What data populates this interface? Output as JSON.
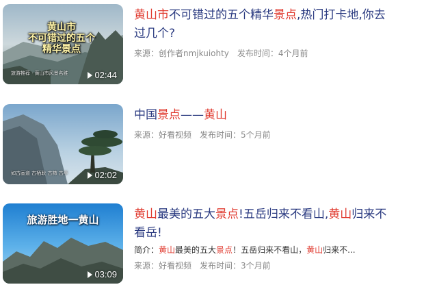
{
  "items": [
    {
      "thumb_overlay": [
        "黄山市",
        "不可错过的五个",
        "精华景点"
      ],
      "thumb_caption": "旅游推荐 · 黄山市风景名胜",
      "duration": "02:44",
      "title_parts": [
        {
          "text": "黄山市",
          "hl": true
        },
        {
          "text": "不可错过的五个精华",
          "hl": false
        },
        {
          "text": "景点",
          "hl": true
        },
        {
          "text": ",热门打卡地,你去过几个?",
          "hl": false
        }
      ],
      "source": "来源：创作者nmjkuiohty",
      "publish": "发布时间：4个月前"
    },
    {
      "thumb_overlay": [],
      "thumb_caption": "如古画道 古栖耿 古柿 古亭",
      "duration": "02:02",
      "title_parts": [
        {
          "text": "中国",
          "hl": false
        },
        {
          "text": "景点",
          "hl": true
        },
        {
          "text": "——",
          "hl": false
        },
        {
          "text": "黄山",
          "hl": true
        }
      ],
      "source": "来源：好看视频",
      "publish": "发布时间：5个月前"
    },
    {
      "thumb_overlay": [
        "旅游胜地一黄山"
      ],
      "thumb_caption": "",
      "duration": "03:09",
      "title_parts": [
        {
          "text": "黄山",
          "hl": true
        },
        {
          "text": "最美的五大",
          "hl": false
        },
        {
          "text": "景点",
          "hl": true
        },
        {
          "text": "!五岳归来不看山,",
          "hl": false
        },
        {
          "text": "黄山",
          "hl": true
        },
        {
          "text": "归来不看岳!",
          "hl": false
        }
      ],
      "desc_parts": [
        {
          "text": "简介：",
          "hl": false
        },
        {
          "text": "黄山",
          "hl": true
        },
        {
          "text": "最美的五大",
          "hl": false
        },
        {
          "text": "景点",
          "hl": true
        },
        {
          "text": "！五岳归来不看山，",
          "hl": false
        },
        {
          "text": "黄山",
          "hl": true
        },
        {
          "text": "归来不...",
          "hl": false
        }
      ],
      "source": "来源：好看视频",
      "publish": "发布时间：3个月前"
    }
  ],
  "colors": {
    "title": "#2a3a80",
    "highlight": "#e03a2f",
    "meta": "#8a8a8a"
  },
  "icons": {
    "play": "play-icon"
  }
}
